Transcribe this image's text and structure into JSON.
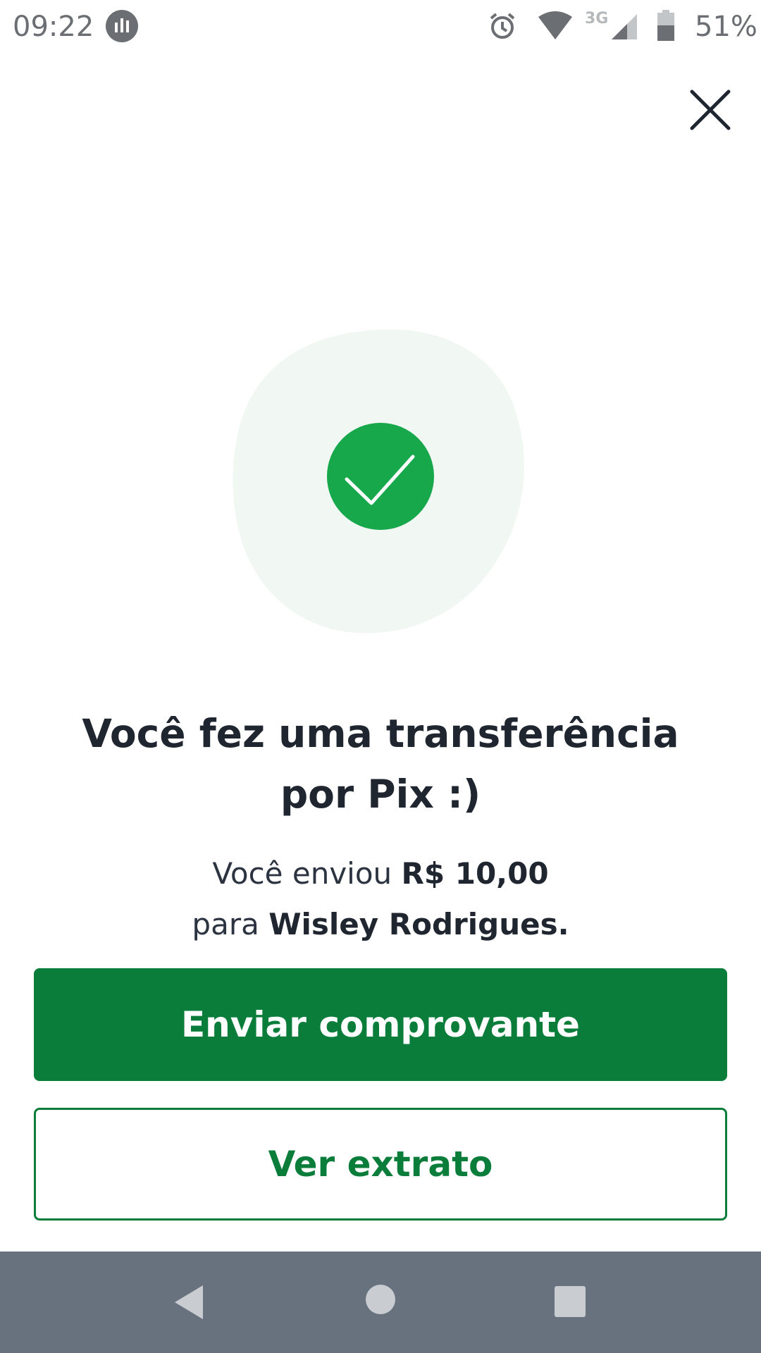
{
  "status_bar": {
    "time": "09:22",
    "network_type": "3G",
    "battery_percent": "51%",
    "icons": [
      "app-notification-icon",
      "alarm-icon",
      "wifi-icon",
      "cell-signal-icon",
      "battery-icon"
    ]
  },
  "header": {
    "close_icon": "close-icon"
  },
  "illustration": {
    "icon": "success-check-icon",
    "blob_color": "#f1f7f3",
    "circle_color": "#17a84b"
  },
  "message": {
    "title": "Você fez uma transferência por Pix :)",
    "subtitle_prefix": "Você enviou ",
    "amount": "R$ 10,00",
    "subtitle_middle": "para ",
    "recipient": "Wisley Rodrigues."
  },
  "actions": {
    "primary_label": "Enviar comprovante",
    "secondary_label": "Ver extrato",
    "accent_color": "#0b7d3a"
  },
  "nav_bar": {
    "icons": [
      "back-icon",
      "home-icon",
      "recent-apps-icon"
    ]
  }
}
